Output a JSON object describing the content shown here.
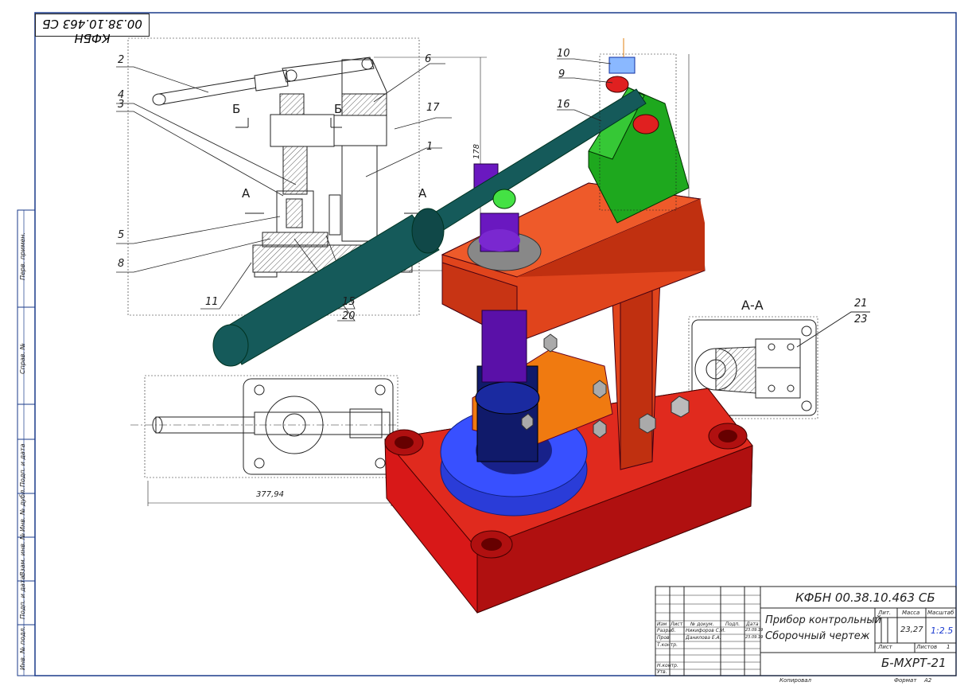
{
  "drawing": {
    "stamp_code": "КФБН 00.38.10.463 СБ",
    "dimension_width": "377,94",
    "dimension_height": "178",
    "section_a_label": "А-А",
    "section_mark_a": "А",
    "section_mark_b": "Б"
  },
  "callouts": {
    "c2": "2",
    "c4": "4",
    "c3": "3",
    "c6": "6",
    "c17": "17",
    "c1": "1",
    "c5": "5",
    "c8": "8",
    "c11": "11",
    "c15": "15",
    "c20": "20",
    "c10": "10",
    "c9": "9",
    "c16": "16",
    "c21": "21",
    "c23": "23"
  },
  "side_labels": {
    "perv_primen": "Перв. примен.",
    "sprav": "Справ. №",
    "podp_data_1": "Подп. и дата",
    "inv_dubl": "Инв. № дубл.",
    "vzam_inv": "Взам. инв. №",
    "podp_data_2": "Подп. и дата",
    "inv_podl": "Инв. № подл."
  },
  "title_block": {
    "code": "КФБН 00.38.10.463 СБ",
    "name_line1": "Прибор контрольный",
    "name_line2": "Сборочный чертеж",
    "col_izm": "Изм",
    "col_list": "Лист",
    "col_doc": "№ докум.",
    "col_podp": "Подп.",
    "col_date": "Дата",
    "row_razrab": "Разраб.",
    "row_prov": "Пров.",
    "row_tkontr": "Т.контр.",
    "row_nkontr": "Н.контр.",
    "row_utv": "Утв.",
    "razrab_name": "Никифоров С.И.",
    "prov_name": "Данилова Е.А.",
    "razrab_date": "23.09.19",
    "prov_date": "23.09.19",
    "lit_label": "Лит.",
    "massa_label": "Масса",
    "masshtab_label": "Масштаб",
    "massa_value": "23,27",
    "masshtab_value": "1:2.5",
    "list_label": "Лист",
    "listov_label": "Листов",
    "listov_value": "1",
    "group": "Б-МХРТ-21",
    "kopiroval": "Копировал",
    "format_label": "Формат",
    "format_value": "А2"
  }
}
